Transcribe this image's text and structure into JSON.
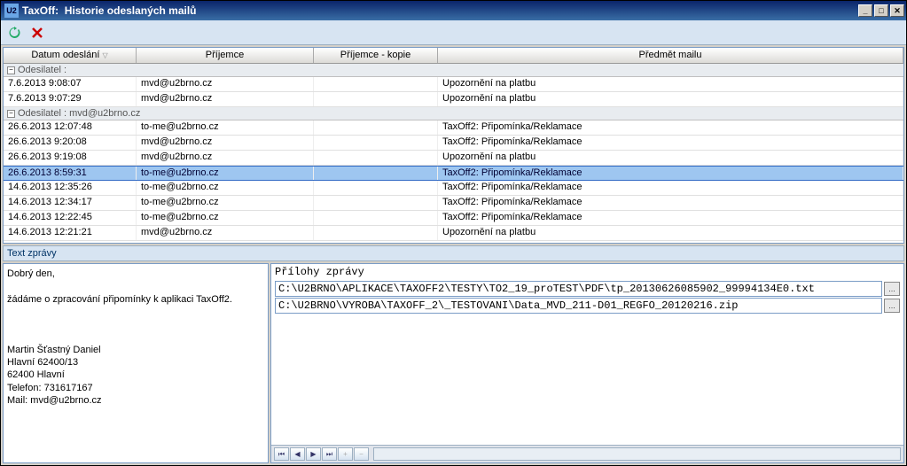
{
  "window": {
    "app": "TaxOff:",
    "title": "Historie odeslaných mailů"
  },
  "columns": {
    "date": "Datum odeslání",
    "to": "Příjemce",
    "cc": "Příjemce - kopie",
    "subject": "Předmět mailu"
  },
  "groups": [
    {
      "label": "Odesilatel :",
      "rows": [
        {
          "date": "7.6.2013 9:08:07",
          "to": "mvd@u2brno.cz",
          "cc": "",
          "subject": "Upozornění na platbu"
        },
        {
          "date": "7.6.2013 9:07:29",
          "to": "mvd@u2brno.cz",
          "cc": "",
          "subject": "Upozornění na platbu"
        }
      ]
    },
    {
      "label": "Odesilatel : mvd@u2brno.cz",
      "rows": [
        {
          "date": "26.6.2013 12:07:48",
          "to": "to-me@u2brno.cz",
          "cc": "",
          "subject": "TaxOff2: Připomínka/Reklamace"
        },
        {
          "date": "26.6.2013 9:20:08",
          "to": "mvd@u2brno.cz",
          "cc": "",
          "subject": "TaxOff2: Připomínka/Reklamace"
        },
        {
          "date": "26.6.2013 9:19:08",
          "to": "mvd@u2brno.cz",
          "cc": "",
          "subject": "Upozornění na platbu"
        },
        {
          "date": "26.6.2013 8:59:31",
          "to": "to-me@u2brno.cz",
          "cc": "",
          "subject": "TaxOff2: Připomínka/Reklamace",
          "selected": true
        },
        {
          "date": "14.6.2013 12:35:26",
          "to": "to-me@u2brno.cz",
          "cc": "",
          "subject": "TaxOff2: Připomínka/Reklamace"
        },
        {
          "date": "14.6.2013 12:34:17",
          "to": "to-me@u2brno.cz",
          "cc": "",
          "subject": "TaxOff2: Připomínka/Reklamace"
        },
        {
          "date": "14.6.2013 12:22:45",
          "to": "to-me@u2brno.cz",
          "cc": "",
          "subject": "TaxOff2: Připomínka/Reklamace"
        },
        {
          "date": "14.6.2013 12:21:21",
          "to": "mvd@u2brno.cz",
          "cc": "",
          "subject": "Upozornění na platbu"
        }
      ]
    }
  ],
  "section_label": "Text zprávy",
  "message": {
    "greeting": "Dobrý den,",
    "body": "žádáme o zpracování připomínky k aplikaci TaxOff2.",
    "sig_name": " Martin  Šťastný Daniel",
    "sig_addr1": "Hlavní  62400/13",
    "sig_addr2": "62400  Hlavní",
    "sig_phone": "Telefon: 731617167",
    "sig_mail": "Mail: mvd@u2brno.cz"
  },
  "attachments": {
    "label": "Přílohy zprávy",
    "items": [
      "C:\\U2BRNO\\APLIKACE\\TAXOFF2\\TESTY\\TO2_19_proTEST\\PDF\\tp_20130626085902_99994134E0.txt",
      "C:\\U2BRNO\\VYROBA\\TAXOFF_2\\_TESTOVANI\\Data_MVD_211-D01_REGFO_20120216.zip"
    ]
  },
  "icons": {
    "minus": "−",
    "toggle": "−"
  }
}
